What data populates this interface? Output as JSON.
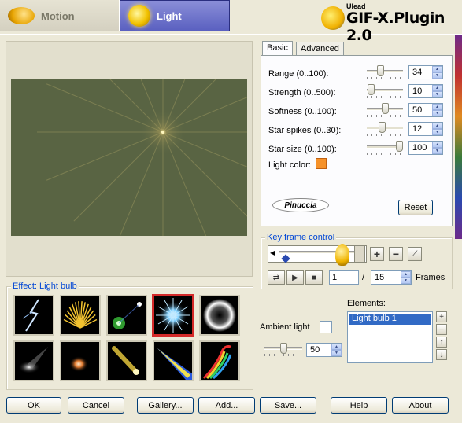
{
  "top_tabs": [
    {
      "label": "Motion",
      "icon": "motion-icon",
      "active": false
    },
    {
      "label": "Light",
      "icon": "bulb-icon",
      "active": true
    }
  ],
  "brand": {
    "small": "Ulead",
    "main": "GIF-X.Plugin 2.0"
  },
  "sub_tabs": {
    "basic": "Basic",
    "advanced": "Advanced"
  },
  "basic": {
    "params": [
      {
        "label": "Range (0..100):",
        "value": "34",
        "fraction": 0.34
      },
      {
        "label": "Strength (0..500):",
        "value": "10",
        "fraction": 0.02
      },
      {
        "label": "Softness (0..100):",
        "value": "50",
        "fraction": 0.5
      },
      {
        "label": "Star spikes (0..30):",
        "value": "12",
        "fraction": 0.4
      },
      {
        "label": "Star size (0..100):",
        "value": "100",
        "fraction": 1.0
      }
    ],
    "light_color_label": "Light color:",
    "light_color": "#f6922a",
    "signature": "Pinuccia",
    "reset_label": "Reset"
  },
  "keyframe": {
    "title": "Key frame control",
    "current_frame": "1",
    "separator": "/",
    "total_frames": "15",
    "frames_label": "Frames"
  },
  "effects": {
    "title": "Effect: Light bulb",
    "items": [
      "lightning",
      "burst",
      "lens-flare",
      "star-flare",
      "ring",
      "spotlight",
      "glow",
      "comet",
      "beam",
      "rainbow-swirl"
    ],
    "selected_index": 3
  },
  "ambient": {
    "label": "Ambient light",
    "value": "50",
    "fraction": 0.5
  },
  "elements": {
    "label": "Elements:",
    "items": [
      "Light bulb 1"
    ]
  },
  "buttons": {
    "ok": "OK",
    "cancel": "Cancel",
    "gallery": "Gallery...",
    "add": "Add...",
    "save": "Save...",
    "help": "Help",
    "about": "About"
  },
  "colors": {
    "preview_bg": "#596443",
    "accent_tab": "#5a60c0",
    "selection": "#316ac5"
  }
}
